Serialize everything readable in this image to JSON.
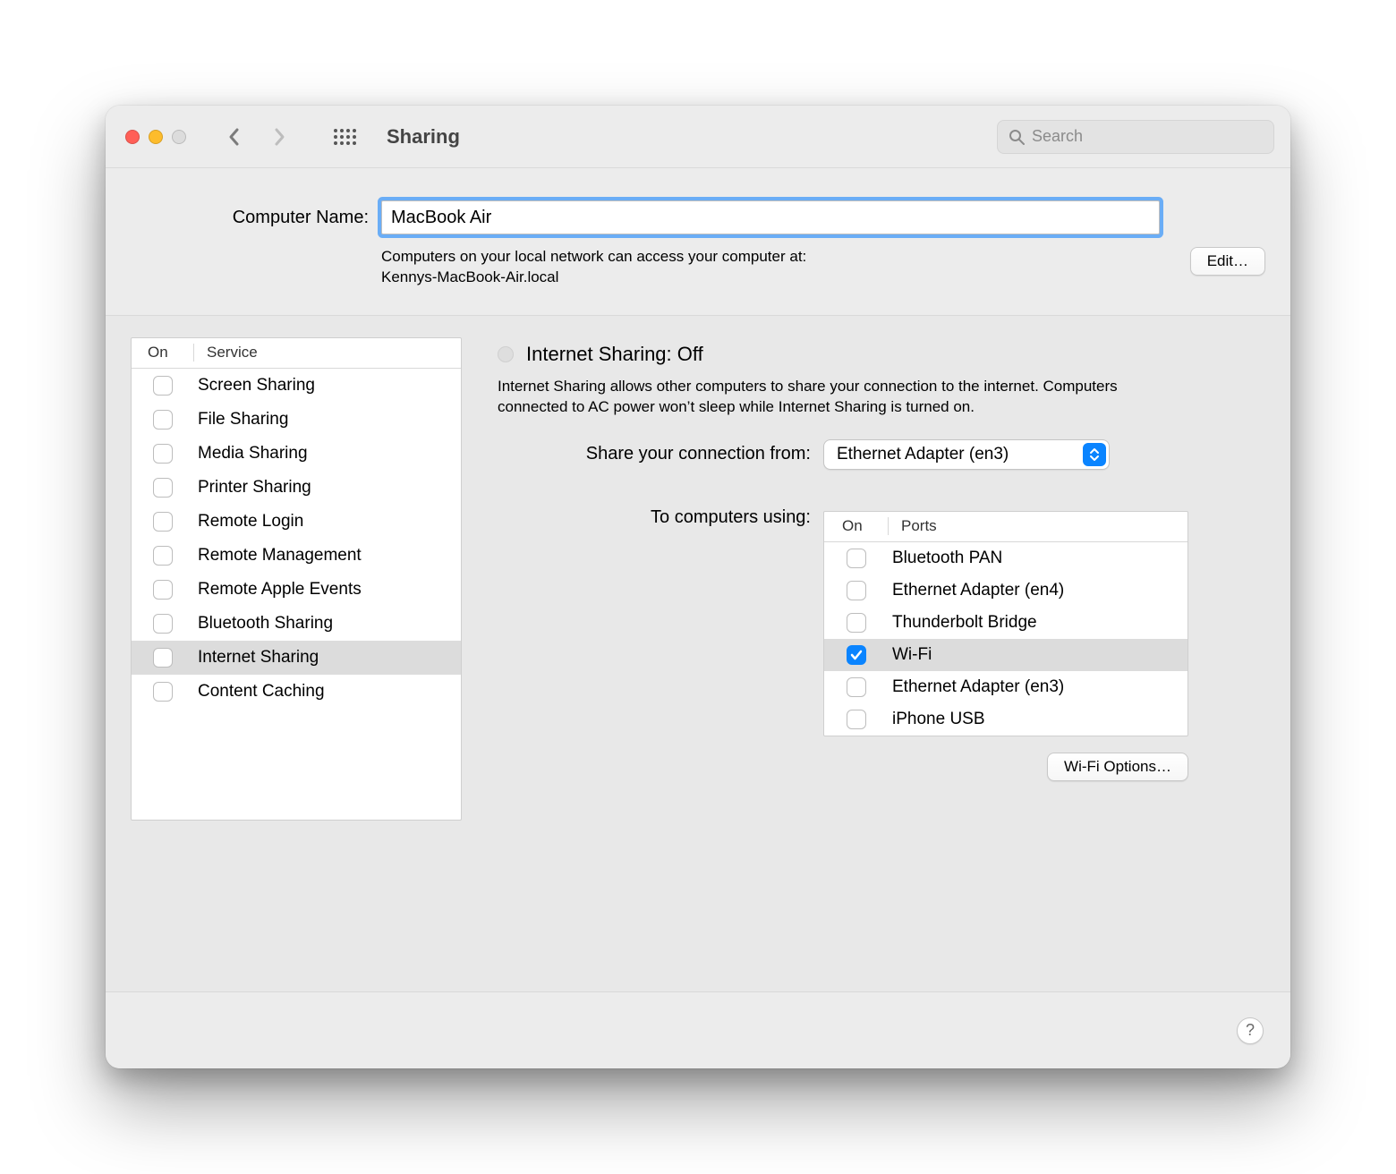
{
  "window": {
    "title": "Sharing",
    "search_placeholder": "Search"
  },
  "computer_name": {
    "label": "Computer Name:",
    "value": "MacBook Air",
    "hint_line1": "Computers on your local network can access your computer at:",
    "hint_line2": "Kennys-MacBook-Air.local",
    "edit_label": "Edit…"
  },
  "services": {
    "columns": {
      "on": "On",
      "service": "Service"
    },
    "items": [
      {
        "label": "Screen Sharing",
        "on": false,
        "selected": false
      },
      {
        "label": "File Sharing",
        "on": false,
        "selected": false
      },
      {
        "label": "Media Sharing",
        "on": false,
        "selected": false
      },
      {
        "label": "Printer Sharing",
        "on": false,
        "selected": false
      },
      {
        "label": "Remote Login",
        "on": false,
        "selected": false
      },
      {
        "label": "Remote Management",
        "on": false,
        "selected": false
      },
      {
        "label": "Remote Apple Events",
        "on": false,
        "selected": false
      },
      {
        "label": "Bluetooth Sharing",
        "on": false,
        "selected": false
      },
      {
        "label": "Internet Sharing",
        "on": false,
        "selected": true
      },
      {
        "label": "Content Caching",
        "on": false,
        "selected": false
      }
    ]
  },
  "detail": {
    "status_title": "Internet Sharing: Off",
    "description": "Internet Sharing allows other computers to share your connection to the internet. Computers connected to AC power won’t sleep while Internet Sharing is turned on.",
    "share_from_label": "Share your connection from:",
    "share_from_value": "Ethernet Adapter (en3)",
    "to_label": "To computers using:",
    "ports_columns": {
      "on": "On",
      "ports": "Ports"
    },
    "ports": [
      {
        "label": "Bluetooth PAN",
        "on": false,
        "selected": false
      },
      {
        "label": "Ethernet Adapter (en4)",
        "on": false,
        "selected": false
      },
      {
        "label": "Thunderbolt Bridge",
        "on": false,
        "selected": false
      },
      {
        "label": "Wi-Fi",
        "on": true,
        "selected": true
      },
      {
        "label": "Ethernet Adapter (en3)",
        "on": false,
        "selected": false
      },
      {
        "label": "iPhone USB",
        "on": false,
        "selected": false
      }
    ],
    "wifi_options_label": "Wi-Fi Options…"
  },
  "footer": {
    "help_label": "?"
  }
}
